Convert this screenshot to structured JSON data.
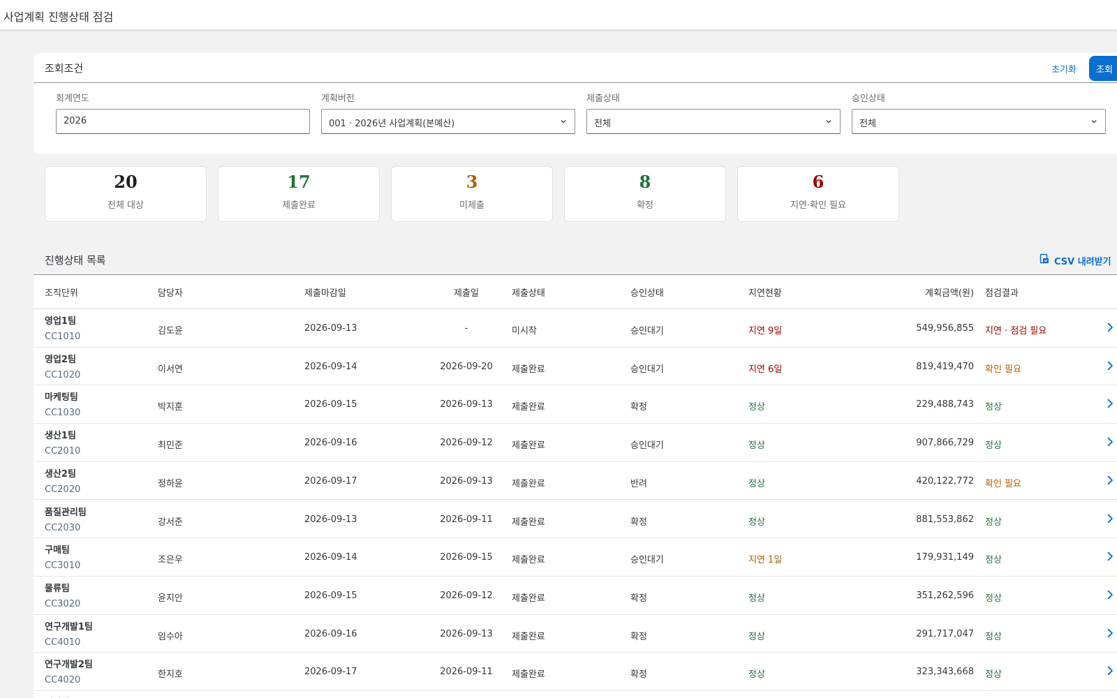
{
  "app": {
    "title": "사업계획 진행상태 점검"
  },
  "filter": {
    "title": "조회조건",
    "reset_label": "초기화",
    "search_label": "조회",
    "fields": [
      {
        "label": "회계연도",
        "value": "2026",
        "type": "input"
      },
      {
        "label": "계획버전",
        "value": "001 · 2026년 사업계획(본예산)",
        "type": "select"
      },
      {
        "label": "제출상태",
        "value": "전체",
        "type": "select"
      },
      {
        "label": "승인상태",
        "value": "전체",
        "type": "select"
      }
    ]
  },
  "kpis": [
    {
      "value": "20",
      "label": "전체 대상",
      "color": "#1d1d1d"
    },
    {
      "value": "17",
      "label": "제출완료",
      "color": "#256f3a"
    },
    {
      "value": "3",
      "label": "미제출",
      "color": "#b35c00"
    },
    {
      "value": "8",
      "label": "확정",
      "color": "#256f3a"
    },
    {
      "value": "6",
      "label": "지연·확인 필요",
      "color": "#a30000"
    }
  ],
  "list": {
    "title": "진행상태 목록",
    "csv_label": "CSV 내려받기",
    "columns": [
      "조직단위",
      "담당자",
      "제출마감일",
      "제출일",
      "제출상태",
      "승인상태",
      "지연현황",
      "계획금액(원)",
      "점검결과"
    ],
    "rows": [
      {
        "org": "영업1팀",
        "code": "CC1010",
        "owner": "김도윤",
        "due": "2026-09-13",
        "submitted": "-",
        "submit_status": "미시작",
        "approval": "승인대기",
        "delay": "지연 9일",
        "delay_color": "#a30000",
        "amount": "549,956,855",
        "result": "지연 · 점검 필요",
        "result_color": "#a30000"
      },
      {
        "org": "영업2팀",
        "code": "CC1020",
        "owner": "이서연",
        "due": "2026-09-14",
        "submitted": "2026-09-20",
        "submit_status": "제출완료",
        "approval": "승인대기",
        "delay": "지연 6일",
        "delay_color": "#a30000",
        "amount": "819,419,470",
        "result": "확인 필요",
        "result_color": "#b35c00"
      },
      {
        "org": "마케팅팀",
        "code": "CC1030",
        "owner": "박지훈",
        "due": "2026-09-15",
        "submitted": "2026-09-13",
        "submit_status": "제출완료",
        "approval": "확정",
        "delay": "정상",
        "delay_color": "#256f3a",
        "amount": "229,488,743",
        "result": "정상",
        "result_color": "#256f3a"
      },
      {
        "org": "생산1팀",
        "code": "CC2010",
        "owner": "최민준",
        "due": "2026-09-16",
        "submitted": "2026-09-12",
        "submit_status": "제출완료",
        "approval": "승인대기",
        "delay": "정상",
        "delay_color": "#256f3a",
        "amount": "907,866,729",
        "result": "정상",
        "result_color": "#256f3a"
      },
      {
        "org": "생산2팀",
        "code": "CC2020",
        "owner": "정하윤",
        "due": "2026-09-17",
        "submitted": "2026-09-13",
        "submit_status": "제출완료",
        "approval": "반려",
        "delay": "정상",
        "delay_color": "#256f3a",
        "amount": "420,122,772",
        "result": "확인 필요",
        "result_color": "#b35c00"
      },
      {
        "org": "품질관리팀",
        "code": "CC2030",
        "owner": "강서준",
        "due": "2026-09-13",
        "submitted": "2026-09-11",
        "submit_status": "제출완료",
        "approval": "확정",
        "delay": "정상",
        "delay_color": "#256f3a",
        "amount": "881,553,862",
        "result": "정상",
        "result_color": "#256f3a"
      },
      {
        "org": "구매팀",
        "code": "CC3010",
        "owner": "조은우",
        "due": "2026-09-14",
        "submitted": "2026-09-15",
        "submit_status": "제출완료",
        "approval": "승인대기",
        "delay": "지연 1일",
        "delay_color": "#b35c00",
        "amount": "179,931,149",
        "result": "정상",
        "result_color": "#256f3a"
      },
      {
        "org": "물류팀",
        "code": "CC3020",
        "owner": "윤지안",
        "due": "2026-09-15",
        "submitted": "2026-09-12",
        "submit_status": "제출완료",
        "approval": "확정",
        "delay": "정상",
        "delay_color": "#256f3a",
        "amount": "351,262,596",
        "result": "정상",
        "result_color": "#256f3a"
      },
      {
        "org": "연구개발1팀",
        "code": "CC4010",
        "owner": "임수아",
        "due": "2026-09-16",
        "submitted": "2026-09-13",
        "submit_status": "제출완료",
        "approval": "확정",
        "delay": "정상",
        "delay_color": "#256f3a",
        "amount": "291,717,047",
        "result": "정상",
        "result_color": "#256f3a"
      },
      {
        "org": "연구개발2팀",
        "code": "CC4020",
        "owner": "한지호",
        "due": "2026-09-17",
        "submitted": "2026-09-11",
        "submit_status": "제출완료",
        "approval": "확정",
        "delay": "정상",
        "delay_color": "#256f3a",
        "amount": "323,343,668",
        "result": "정상",
        "result_color": "#256f3a"
      }
    ],
    "partial_next_row_org": "인사팀"
  },
  "colors": {
    "accent": "#0a6ed1",
    "danger": "#a30000",
    "warning": "#b35c00",
    "success": "#256f3a"
  }
}
